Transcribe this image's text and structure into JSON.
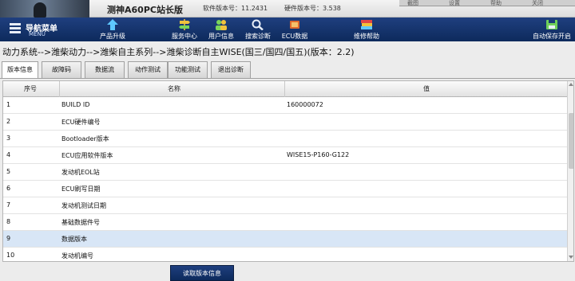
{
  "app": {
    "title": "测神A60PC站长版",
    "software_version": "软件版本号：11.2431",
    "hardware_version": "硬件版本号：3.538",
    "window_buttons": [
      "截图",
      "设置",
      "帮助",
      "关闭"
    ]
  },
  "toolbar": {
    "menu_label": "导航菜单",
    "menu_sub": "MENU",
    "buttons": [
      {
        "label": "产品升级",
        "icon": "upgrade-arrow-icon"
      },
      {
        "label": "服务中心",
        "icon": "signpost-icon"
      },
      {
        "label": "用户信息",
        "icon": "users-icon"
      },
      {
        "label": "搜索诊断",
        "icon": "search-icon"
      },
      {
        "label": "ECU数据",
        "icon": "ecu-chip-icon"
      },
      {
        "label": "维修帮助",
        "icon": "books-icon"
      },
      {
        "label": "自动保存开启",
        "icon": "auto-save-icon"
      }
    ]
  },
  "breadcrumb": "动力系统-->潍柴动力-->潍柴自主系列-->潍柴诊断自主WISE(国三/国四/国五)(版本：2.2)",
  "tabs": [
    "版本信息",
    "故障码",
    "数据流",
    "动作测试",
    "功能测试",
    "退出诊断"
  ],
  "active_tab": "版本信息",
  "table": {
    "columns": [
      "序号",
      "名称",
      "值"
    ],
    "rows": [
      {
        "no": "1",
        "name": "BUILD ID",
        "value": "160000072"
      },
      {
        "no": "2",
        "name": "ECU硬件编号",
        "value": ""
      },
      {
        "no": "3",
        "name": "Bootloader版本",
        "value": ""
      },
      {
        "no": "4",
        "name": "ECU应用软件版本",
        "value": "WISE15-P160-G122"
      },
      {
        "no": "5",
        "name": "发动机EOL站",
        "value": ""
      },
      {
        "no": "6",
        "name": "ECU刷写日期",
        "value": ""
      },
      {
        "no": "7",
        "name": "发动机测试日期",
        "value": ""
      },
      {
        "no": "8",
        "name": "基础数据件号",
        "value": ""
      },
      {
        "no": "9",
        "name": "数据版本",
        "value": ""
      },
      {
        "no": "10",
        "name": "发动机编号",
        "value": ""
      }
    ],
    "selected_row": "9"
  },
  "read_button": "读取版本信息",
  "colors": {
    "toolbar": "#1a3a78",
    "selected_row": "#d8e6f6",
    "button": "#16346d"
  }
}
